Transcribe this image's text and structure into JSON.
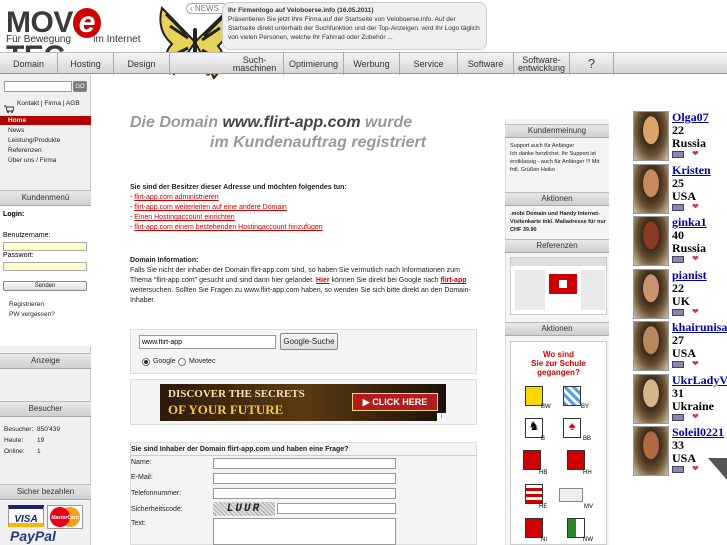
{
  "header": {
    "logo_text_left": "MOV",
    "logo_e": "e",
    "logo_text_right": "TEC",
    "logo_sub_left": "Für Bewegung",
    "logo_sub_right": "im Internet",
    "news_tag": "NEWS",
    "news_title": "Ihr Firmenlogo auf Veloboerse.info (16.05.2011)",
    "news_body": "Präsentieren Sie jetzt Ihre Firma auf der Startseite von Veloboerse.info. Auf der Startseite direkt unterhalb der Suchfunktion und der Top-Anzeigen. wird Ihr Logo täglich von vielen Personen, welche Ihr Fahrrad oder Zubehör ..."
  },
  "nav": {
    "items": [
      "Domain",
      "Hosting",
      "Design",
      "Such-\nmaschinen",
      "Optimierung",
      "Werbung",
      "Service",
      "Software",
      "Software-\nentwicklung",
      "?"
    ]
  },
  "left": {
    "go_label": "GO",
    "top_links": [
      "Kontakt",
      "Firma",
      "AGB"
    ],
    "menu": [
      "Home",
      "News",
      "Leistung/Produkte",
      "Referenzen",
      "Über uns / Firma"
    ],
    "kundenmenu_title": "Kundenmenü",
    "login_label": "Login:",
    "username_label": "Benutzername:",
    "password_label": "Passwort:",
    "send_label": "Senden",
    "register_label": "Registrieren",
    "forgot_label": "PW vergessen?",
    "anzeige_title": "Anzeige",
    "besucher_title": "Besucher",
    "stats": [
      {
        "label": "Besucher:",
        "value": "850'439"
      },
      {
        "label": "Heute:",
        "value": "19"
      },
      {
        "label": "Online:",
        "value": "1"
      }
    ],
    "pay_title": "Sicher bezahlen",
    "visa": "VISA",
    "mastercard": "MasterCard",
    "paypal": "PayPal"
  },
  "main": {
    "hero_line1_pre": "Die Domain ",
    "hero_domain": "www.flirt-app.com",
    "hero_line1_post": " wurde",
    "hero_line2": "im Kundenauftrag registriert",
    "owner_heading": "Sie sind der Besitzer dieser Adresse und möchten folgendes tun:",
    "owner_links": [
      "flirt-app.com administrieren",
      "flirt-app.com weiterleiten auf eine andere Domain",
      "Einen Hostingaccount einrichten",
      "flirt-app.com einem bestehenden Hostingaccount hinzufügen"
    ],
    "info_heading": "Domain Information:",
    "info_text_1": "Falls Sie nicht der inhaber der Domain flirt-app.com sind, so haben Sie vermutlich nach Informationen zum Thema \"flirt-app.com\" gesucht und sind dann hier gelandet. ",
    "info_hier": "Hier",
    "info_text_2": " können Sie direkt bei Google nach ",
    "info_link": "flirt-app",
    "info_text_3": " weitersuchen. Sollten Sie Fragen zu www.flirt-app.com haben, so wenden Sie sich bitte direkt an den Domain-Inhaber.",
    "search_value": "www.flirt-app",
    "search_button": "Google-Suche",
    "radio_google": "Google",
    "radio_movetec": "Movetec",
    "ad_line1": "DISCOVER THE SECRETS",
    "ad_line2": "OF YOUR FUTURE",
    "ad_button": "CLICK HERE",
    "form_heading": "Sie sind Inhaber der Domain flirt-app.com und haben eine Frage?",
    "form_fields": [
      "Name:",
      "E-Mail:",
      "Telefonnummer:",
      "Sicherheitscode:",
      "Text:"
    ],
    "captcha": "LUUR"
  },
  "right": {
    "kundenmeinung_title": "Kundenmeinung",
    "kundenmeinung_text": "Support auch für Anfänger\nIch danke herzlichst. Ihr Support ist erstklassig - auch für Anfänger !!! Mit frdl. Grüßen Heiko",
    "aktionen_title": "Aktionen",
    "aktionen_text": ".mobi Domain und Handy Internet-Visitenkarte inkl. Mailadresse für nur CHF 39.90",
    "referenzen_title": "Referenzen",
    "aktionen2_title": "Aktionen",
    "school_title": "Wo sind\nSie zur Schule\ngegangen?",
    "states": [
      "BW",
      "BY",
      "B",
      "BB",
      "HB",
      "HH",
      "HE",
      "MV",
      "NI",
      "NW"
    ]
  },
  "profiles": [
    {
      "name": "Olga07",
      "age": "22",
      "country": "Russia",
      "color": "#d9a36a"
    },
    {
      "name": "Kristen",
      "age": "25",
      "country": "USA",
      "color": "#c88a5c"
    },
    {
      "name": "ginka1",
      "age": "40",
      "country": "Russia",
      "color": "#8a3b24"
    },
    {
      "name": "pianist",
      "age": "22",
      "country": "UK",
      "color": "#c7946d"
    },
    {
      "name": "khairunisa",
      "age": "27",
      "country": "USA",
      "color": "#b9875e"
    },
    {
      "name": "UkrLadyV",
      "age": "31",
      "country": "Ukraine",
      "color": "#d8b48a"
    },
    {
      "name": "Soleil0221",
      "age": "33",
      "country": "USA",
      "color": "#b06a44"
    }
  ]
}
